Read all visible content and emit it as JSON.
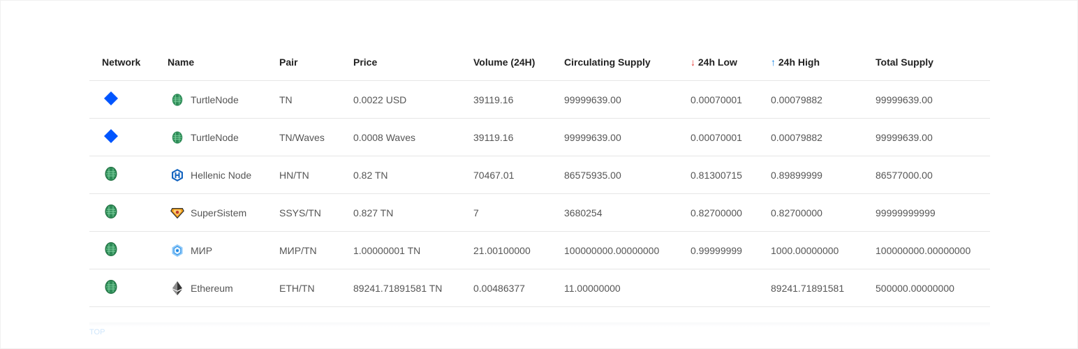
{
  "table": {
    "headers": {
      "network": "Network",
      "name": "Name",
      "pair": "Pair",
      "price": "Price",
      "volume": "Volume (24H)",
      "circulating": "Circulating Supply",
      "low": "24h Low",
      "low_arrow": "↓",
      "high": "24h High",
      "high_arrow": "↑",
      "total": "Total Supply"
    },
    "rows": [
      {
        "network": "waves",
        "icon": "turtlenode-icon",
        "name": "TurtleNode",
        "pair": "TN",
        "price": "0.0022 USD",
        "volume": "39119.16",
        "circulating": "99999639.00",
        "low": "0.00070001",
        "high": "0.00079882",
        "total": "99999639.00"
      },
      {
        "network": "waves",
        "icon": "turtlenode-icon",
        "name": "TurtleNode",
        "pair": "TN/Waves",
        "price": "0.0008 Waves",
        "volume": "39119.16",
        "circulating": "99999639.00",
        "low": "0.00070001",
        "high": "0.00079882",
        "total": "99999639.00"
      },
      {
        "network": "tn",
        "icon": "hellenic-node-icon",
        "name": "Hellenic Node",
        "pair": "HN/TN",
        "price": "0.82 TN",
        "volume": "70467.01",
        "circulating": "86575935.00",
        "low": "0.81300715",
        "high": "0.89899999",
        "total": "86577000.00"
      },
      {
        "network": "tn",
        "icon": "supersistem-icon",
        "name": "SuperSistem",
        "pair": "SSYS/TN",
        "price": "0.827 TN",
        "volume": "7",
        "circulating": "3680254",
        "low": "0.82700000",
        "high": "0.82700000",
        "total": "99999999999"
      },
      {
        "network": "tn",
        "icon": "mir-icon",
        "name": "МИР",
        "pair": "МИР/TN",
        "price": "1.00000001 TN",
        "volume": "21.00100000",
        "circulating": "100000000.00000000",
        "low": "0.99999999",
        "high": "1000.00000000",
        "total": "100000000.00000000"
      },
      {
        "network": "tn",
        "icon": "ethereum-icon",
        "name": "Ethereum",
        "pair": "ETH/TN",
        "price": "89241.71891581 TN",
        "volume": "0.00486377",
        "circulating": "11.00000000",
        "low": "",
        "high": "89241.71891581",
        "total": "500000.00000000"
      }
    ]
  },
  "colors": {
    "waves_blue": "#0055ff",
    "turtle_green": "#2e8b57",
    "low_red": "#e53935",
    "high_blue": "#1e88e5"
  },
  "footer": {
    "link_text": "TOP"
  }
}
